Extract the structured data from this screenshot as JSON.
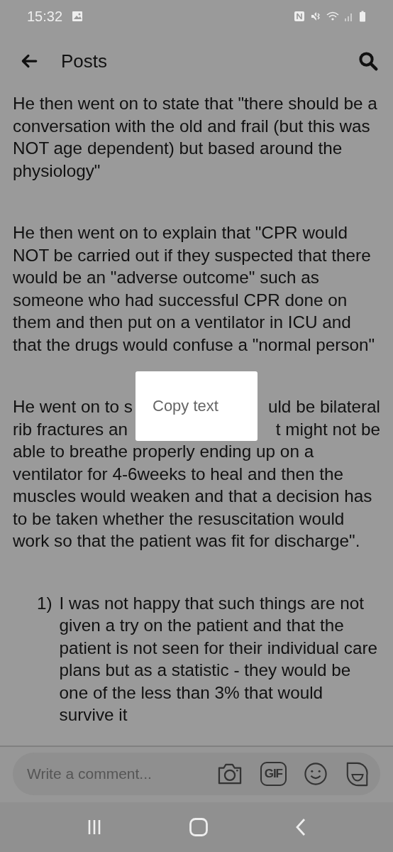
{
  "status_bar": {
    "time": "15:32"
  },
  "app_bar": {
    "title": "Posts"
  },
  "paragraphs": [
    {
      "kind": "text",
      "text": "He then went on to state that \"there should be a conversation with the old and frail (but this was NOT age dependent) but based around the physiology\""
    },
    {
      "kind": "text",
      "text": "He then went on to explain that \"CPR would NOT be carried out if they suspected that there would be an \"adverse outcome\" such as someone who had successful CPR done on them and then put on a ventilator in ICU and that the drugs would confuse a \"normal person\""
    },
    {
      "kind": "partly_covered",
      "lines": [
        {
          "left": "He went on to s",
          "right": "uld be bilateral"
        },
        {
          "left": "rib fractures an",
          "right": "t might not be"
        }
      ],
      "rest": "able to breathe properly ending up on a ventilator for 4-6weeks to heal and then the muscles would weaken and that a decision has to be taken whether the resuscitation would work so that the patient was fit for discharge\"."
    },
    {
      "kind": "numbered",
      "number": "1)",
      "text": "I was not happy that such things are not given a try on the patient and that the patient is not seen for their individual care plans but as a statistic - they would be one of the less than 3% that would survive it"
    }
  ],
  "context_menu": {
    "items": [
      "Copy text"
    ]
  },
  "comment_bar": {
    "placeholder": "Write a comment...",
    "gif_label": "GIF"
  }
}
